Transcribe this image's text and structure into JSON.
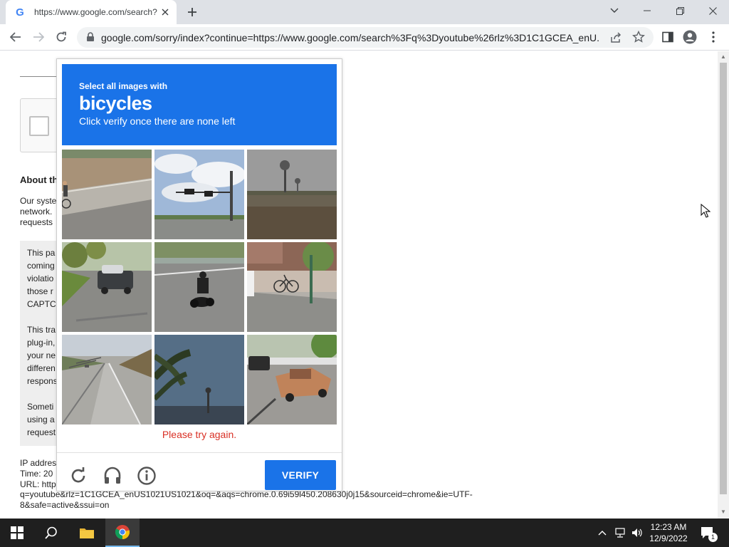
{
  "browser": {
    "tab_title": "https://www.google.com/search?",
    "favicon_letter": "G",
    "url": "google.com/sorry/index?continue=https://www.google.com/search%3Fq%3Dyoutube%26rlz%3D1C1GCEA_enU..."
  },
  "page": {
    "about_title": "About th",
    "body_lines": [
      "Our syste",
      "network.",
      "requests"
    ],
    "info_paragraphs": [
      [
        "This pa",
        "coming",
        "violatio",
        "those r",
        "CAPTC"
      ],
      [
        "This tra",
        "plug-in,",
        "your ne",
        "differen",
        "respons"
      ],
      [
        "Someti",
        "using a",
        "request"
      ]
    ],
    "ip_lines": [
      "IP addres",
      "Time: 20",
      "URL: http"
    ],
    "url_continuation": [
      "q=youtube&rlz=1C1GCEA_enUS1021US1021&oq=&aqs=chrome.0.69i59l450.208630j0j15&sourceid=chrome&ie=UTF-",
      "8&safe=active&ssui=on"
    ]
  },
  "captcha": {
    "instruction_small": "Select all images with",
    "instruction_target": "bicycles",
    "instruction_sub": "Click verify once there are none left",
    "error_message": "Please try again.",
    "verify_label": "VERIFY",
    "tiles": [
      {
        "name": "captcha-tile-1",
        "desc": "road-with-cyclist"
      },
      {
        "name": "captcha-tile-2",
        "desc": "traffic-light-sky"
      },
      {
        "name": "captcha-tile-3",
        "desc": "palm-trees-hazy"
      },
      {
        "name": "captcha-tile-4",
        "desc": "street-with-car"
      },
      {
        "name": "captcha-tile-5",
        "desc": "motorcycle-on-road"
      },
      {
        "name": "captcha-tile-6",
        "desc": "bicycle-rack-sidewalk"
      },
      {
        "name": "captcha-tile-7",
        "desc": "highway-street-lamps"
      },
      {
        "name": "captcha-tile-8",
        "desc": "palm-tree-sky"
      },
      {
        "name": "captcha-tile-9",
        "desc": "parked-cars"
      }
    ],
    "colors": {
      "header": "#1a73e8",
      "error": "#d93025"
    }
  },
  "taskbar": {
    "time": "12:23 AM",
    "date": "12/9/2022",
    "notification_count": "1"
  }
}
